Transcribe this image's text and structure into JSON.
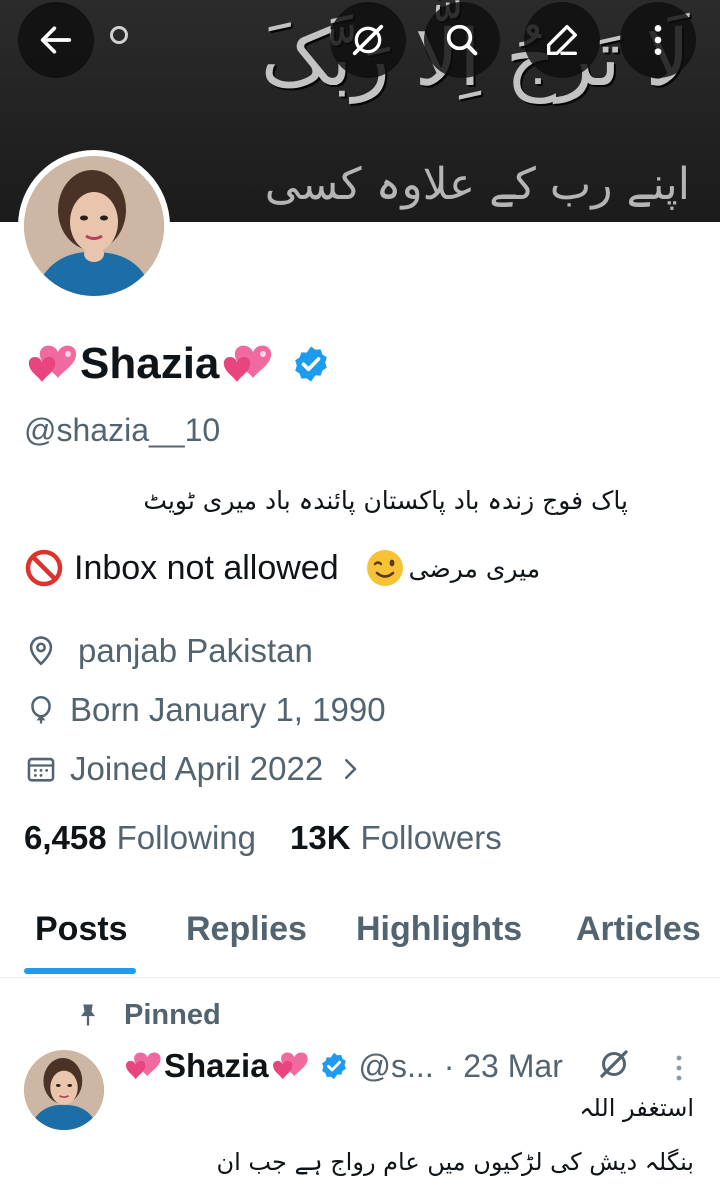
{
  "banner": {
    "calligraphy_line1": "لَا تَرجُ اِلَّا رَبَّکَ",
    "calligraphy_line2": "اپنے رب کے علاوہ کسی سے امید"
  },
  "toolbar": {
    "back_icon": "arrow-left-icon",
    "grok_icon": "grok-icon",
    "search_icon": "search-icon",
    "edit_icon": "edit-icon",
    "more_icon": "more-vertical-icon"
  },
  "profile": {
    "name": "Shazia",
    "handle": "@shazia__10",
    "verified_color": "#1d9bf0",
    "bio_line1": "پاک فوج زندہ باد  پاکستان پائندہ باد  میری ٹویٹ",
    "bio_line2_english": "Inbox not allowed",
    "bio_line2_urdu": "میری مرضی",
    "location": "panjab Pakistan",
    "born": "Born January 1, 1990",
    "joined": "Joined April 2022",
    "following_count": "6,458",
    "following_label": "Following",
    "followers_count": "13K",
    "followers_label": "Followers"
  },
  "tabs": [
    {
      "label": "Posts",
      "active": true
    },
    {
      "label": "Replies",
      "active": false
    },
    {
      "label": "Highlights",
      "active": false
    },
    {
      "label": "Articles",
      "active": false
    }
  ],
  "post": {
    "pinned_label": "Pinned",
    "author": "Shazia",
    "handle_truncated": "@s...",
    "date": "· 23 Mar",
    "line1": "استغفر اللہ",
    "line2": "بنگلہ دیش کی لڑکیوں میں عام رواج ہے جب ان"
  },
  "colors": {
    "accent": "#1d9bf0",
    "text_primary": "#0f1419",
    "text_secondary": "#536471"
  }
}
